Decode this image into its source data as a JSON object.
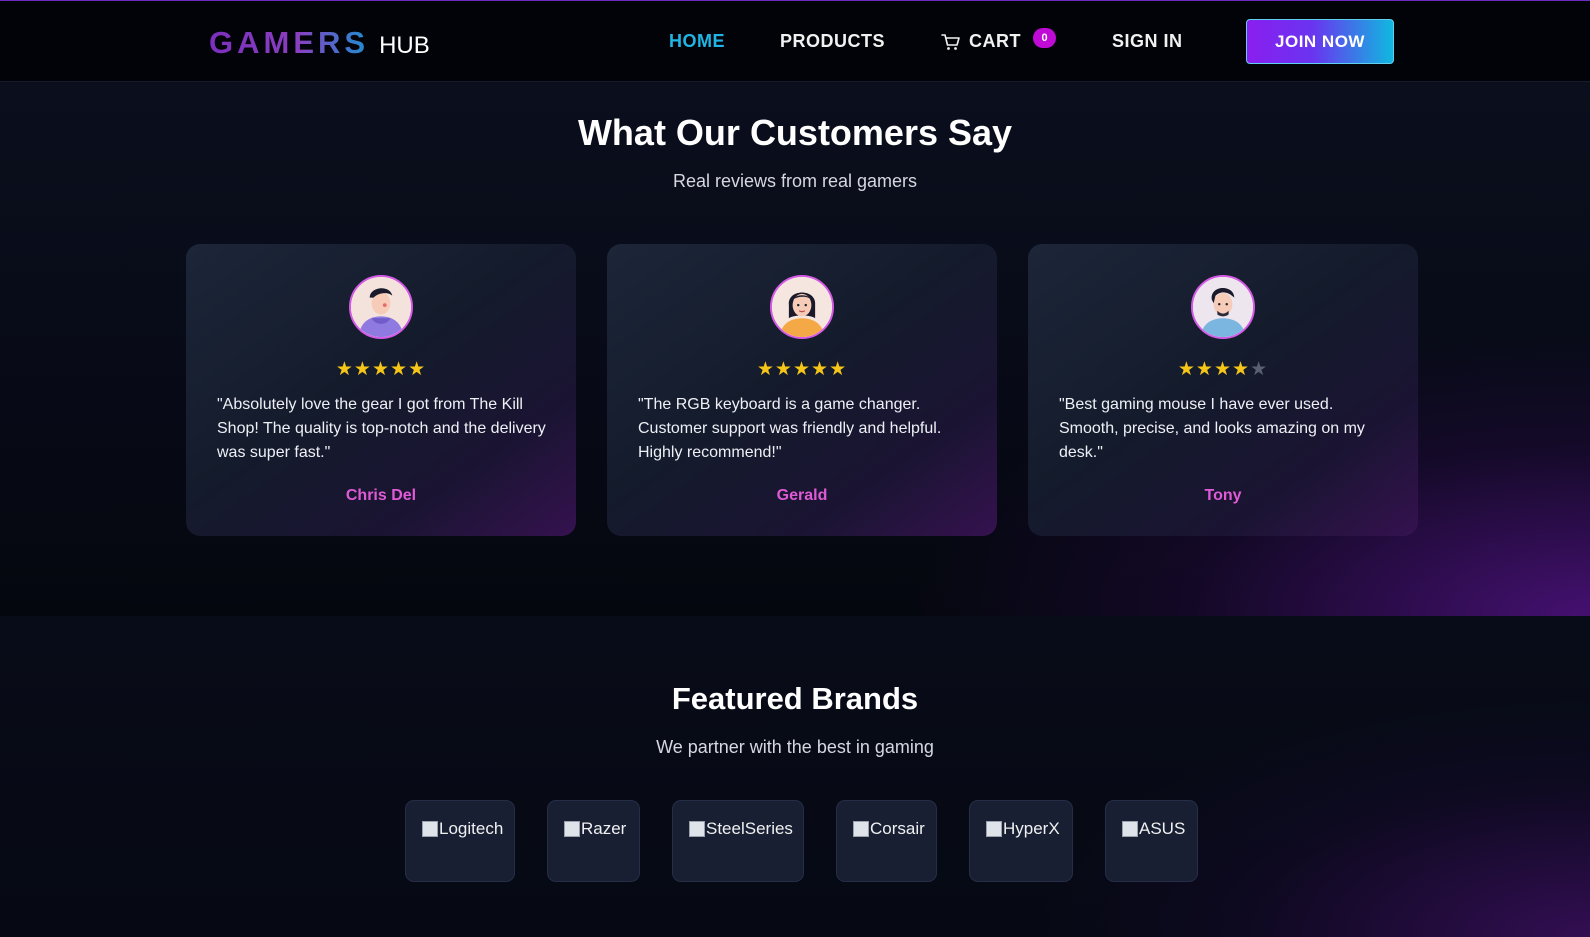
{
  "nav": {
    "logo_primary": "GAMERS",
    "logo_secondary": "HUB",
    "links": {
      "home": "HOME",
      "products": "PRODUCTS",
      "cart": "CART",
      "sign_in": "SIGN IN"
    },
    "cart_count": "0",
    "join_label": "JOIN NOW",
    "active_link": "home",
    "accent_color": "#1fb6e6"
  },
  "testimonials": {
    "title": "What Our Customers Say",
    "subtitle": "Real reviews from real gamers",
    "reviews": [
      {
        "rating": 5,
        "max_rating": 5,
        "quote": "\"Absolutely love the gear I got from The Kill Shop! The quality is top-notch and the delivery was super fast.\"",
        "name": "Chris Del",
        "avatar_icon": "avatar-male-purple-hoodie"
      },
      {
        "rating": 5,
        "max_rating": 5,
        "quote": "\"The RGB keyboard is a game changer. Customer support was friendly and helpful. Highly recommend!\"",
        "name": "Gerald",
        "avatar_icon": "avatar-female-orange-top"
      },
      {
        "rating": 4,
        "max_rating": 5,
        "quote": "\"Best gaming mouse I have ever used. Smooth, precise, and looks amazing on my desk.\"",
        "name": "Tony",
        "avatar_icon": "avatar-male-blue-shirt"
      }
    ]
  },
  "brands": {
    "title": "Featured Brands",
    "subtitle": "We partner with the best in gaming",
    "items": [
      "Logitech",
      "Razer",
      "SteelSeries",
      "Corsair",
      "HyperX",
      "ASUS"
    ]
  },
  "colors": {
    "star": "#f5c518",
    "reviewer_name": "#e05ad6",
    "cart_badge": "#c00ad6"
  }
}
